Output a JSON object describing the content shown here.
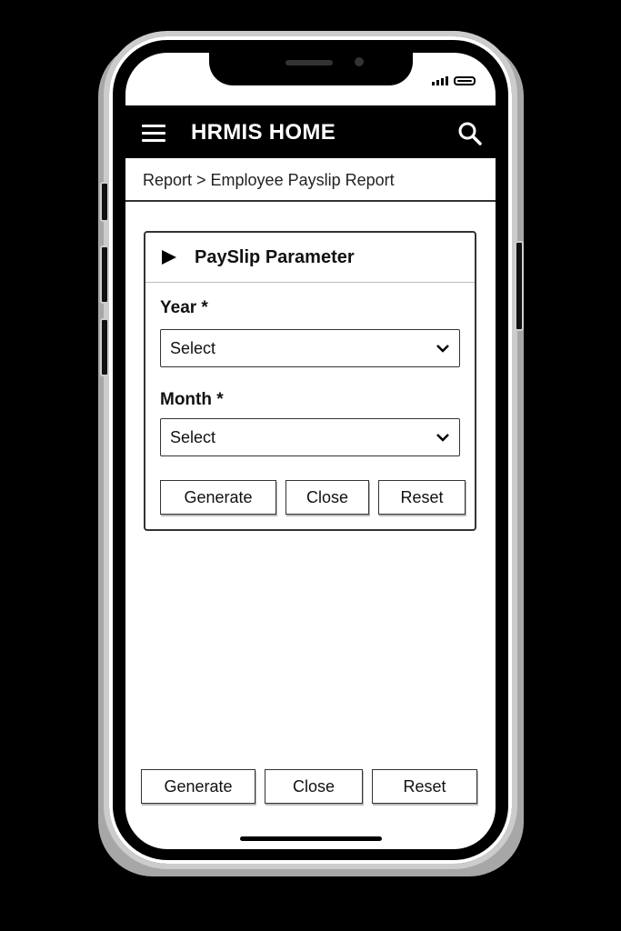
{
  "header": {
    "title": "HRMIS HOME",
    "menu_icon": "hamburger-menu-icon",
    "search_icon": "search-icon"
  },
  "breadcrumb": {
    "text": "Report > Employee Payslip Report"
  },
  "panel": {
    "title": "PaySlip Parameter",
    "year": {
      "label": "Year *",
      "value": "Select"
    },
    "month": {
      "label": "Month *",
      "value": "Select"
    },
    "buttons": {
      "generate": "Generate",
      "close": "Close",
      "reset": "Reset"
    }
  },
  "footer_buttons": {
    "generate": "Generate",
    "close": "Close",
    "reset": "Reset"
  }
}
